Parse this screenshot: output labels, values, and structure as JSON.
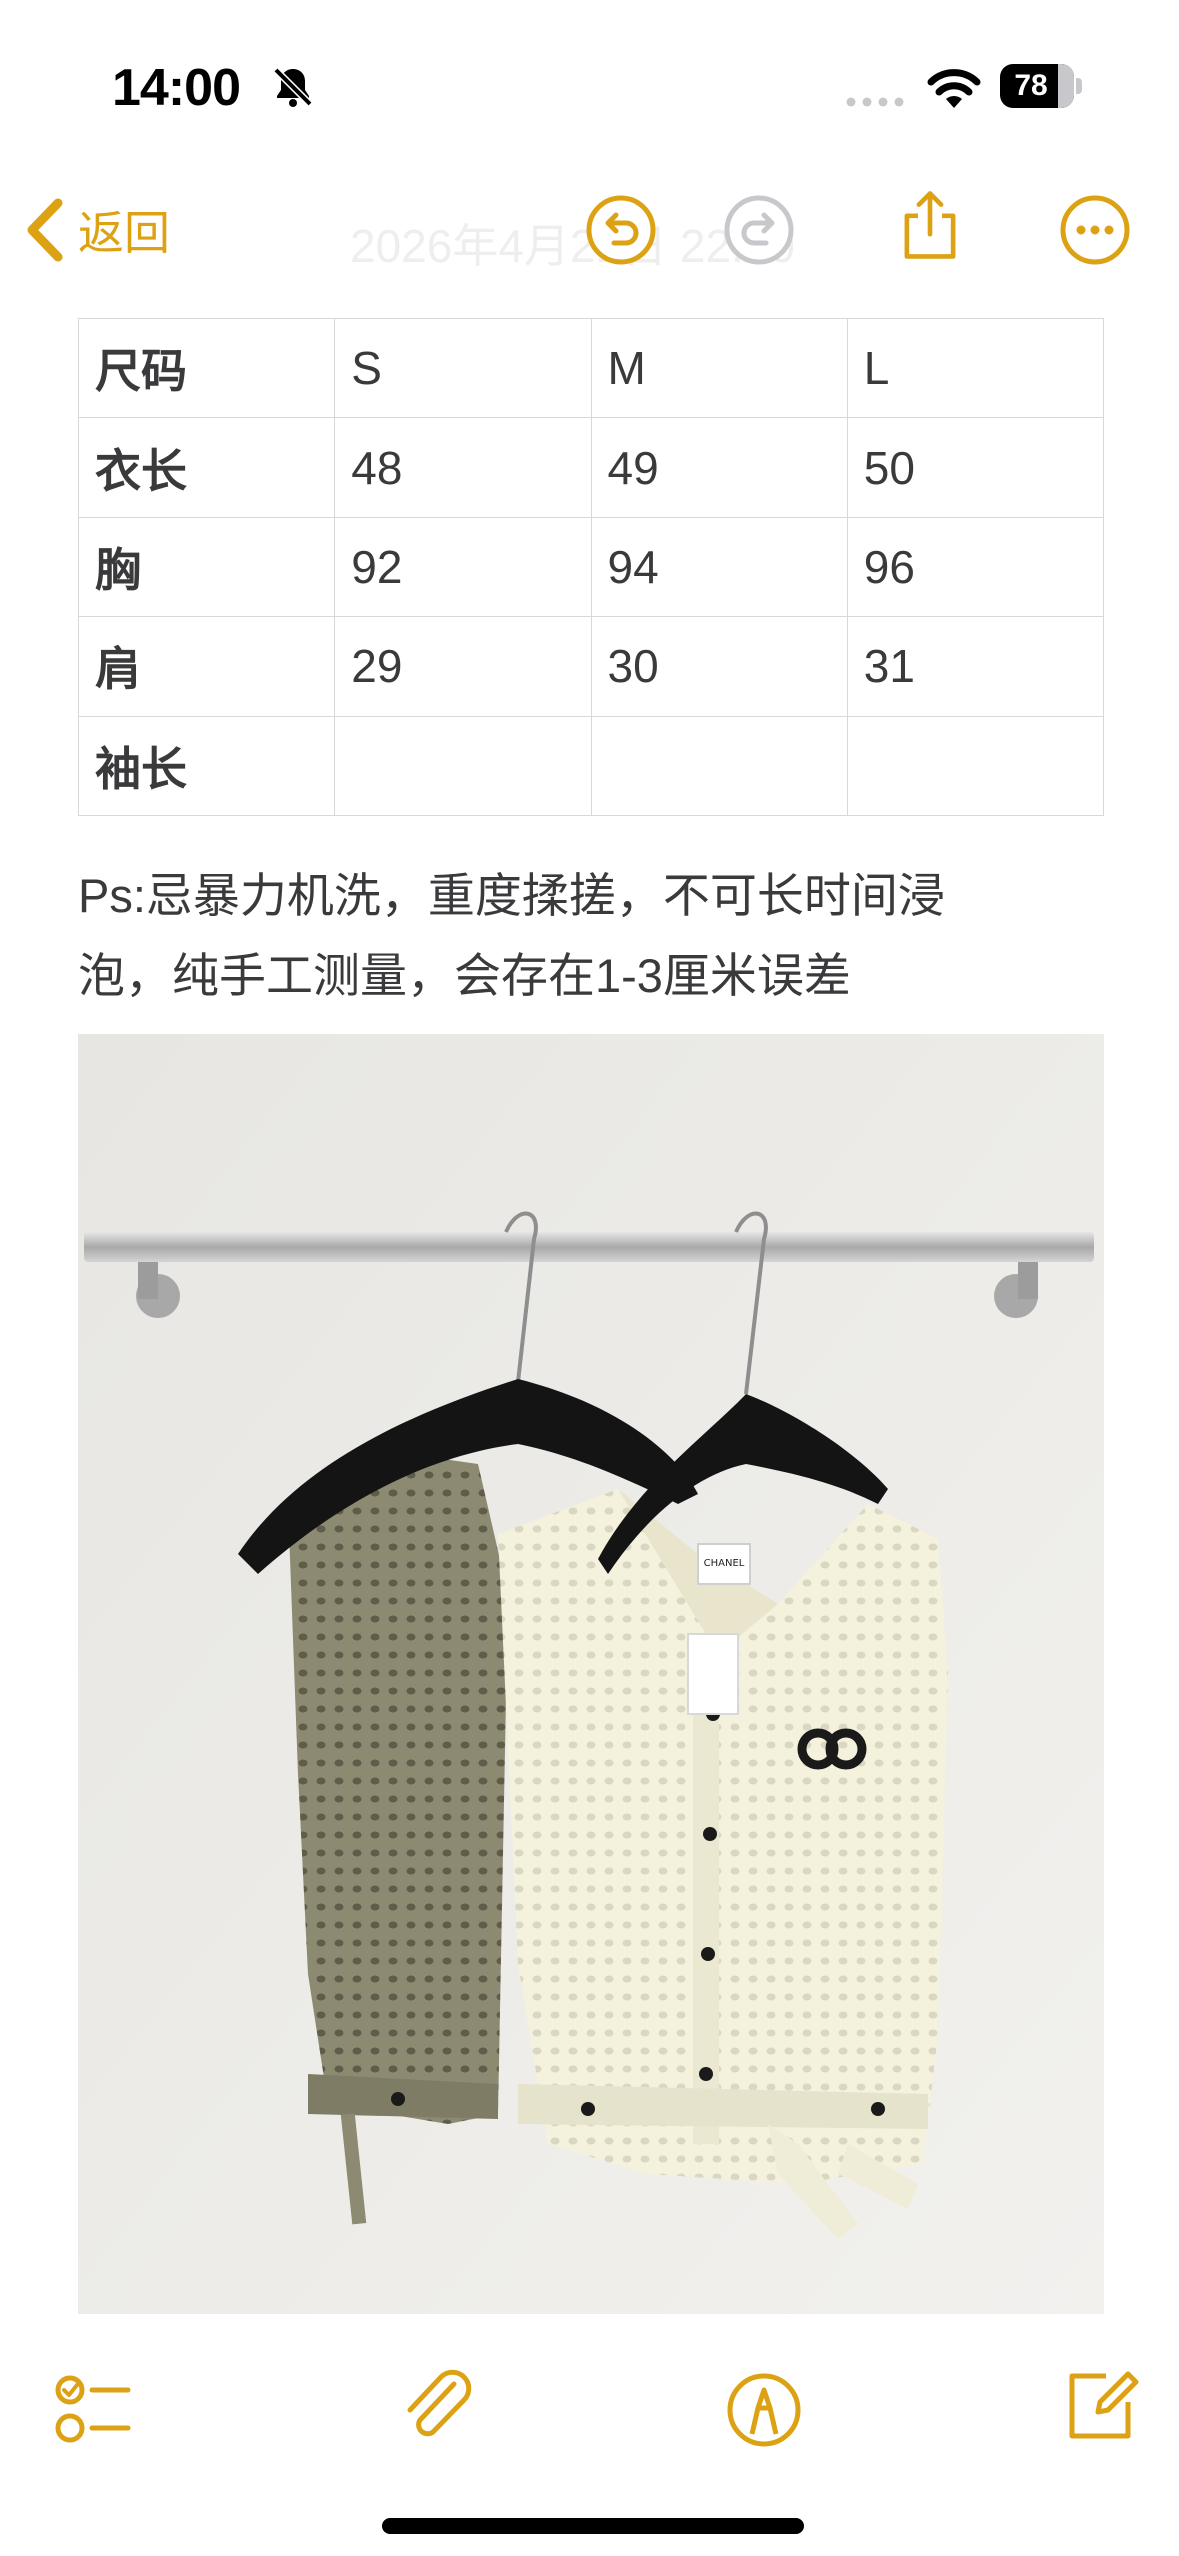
{
  "status_bar": {
    "time": "14:00",
    "battery_level": "78",
    "icons": [
      "bell-slash-icon",
      "cellular-dots-icon",
      "wifi-icon",
      "battery-icon"
    ]
  },
  "nav_bar": {
    "back_label": "返回",
    "title": "2026年4月21日 22:00",
    "icons": [
      "chevron-left-icon",
      "undo-icon",
      "redo-icon",
      "share-icon",
      "more-icon"
    ]
  },
  "size_table": {
    "header": [
      "尺码",
      "S",
      "M",
      "L"
    ],
    "rows": [
      [
        "衣长",
        "48",
        "49",
        "50"
      ],
      [
        "胸",
        "92",
        "94",
        "96"
      ],
      [
        "肩",
        "29",
        "30",
        "31"
      ],
      [
        "袖长",
        "",
        "",
        ""
      ]
    ]
  },
  "note": {
    "line1": "Ps:忌暴力机洗，重度揉搓，不可长时间浸",
    "line2": "泡，纯手工测量，会存在1-3厘米误差"
  },
  "photo": {
    "tag_text": "CHANEL"
  },
  "toolbar": {
    "icons": [
      "checklist-icon",
      "paperclip-icon",
      "markup-pen-icon",
      "compose-icon"
    ]
  },
  "colors": {
    "accent": "#dca214",
    "text": "#3a3a3c",
    "grid": "#d8d8d8"
  }
}
